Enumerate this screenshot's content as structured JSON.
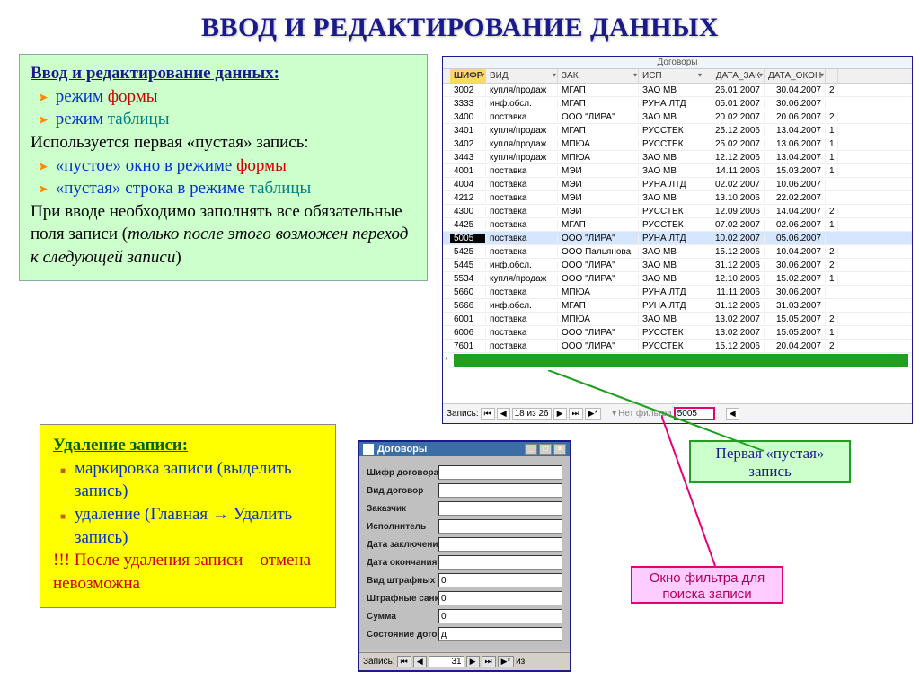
{
  "title": "ВВОД И РЕДАКТИРОВАНИЕ ДАННЫХ",
  "intro": {
    "heading": "Ввод и редактирование данных:",
    "b1_a": "режим ",
    "b1_b": "формы",
    "b2_a": "режим ",
    "b2_b": "таблицы",
    "line1": "Используется первая «пустая» запись:",
    "b3_a": "«пустое» окно в режиме ",
    "b3_b": "формы",
    "b4_a": "«пустая» строка в режиме ",
    "b4_b": "таблицы",
    "line2a": "При вводе необходимо заполнять все обязательные поля записи (",
    "line2b": "только после этого возможен переход к следующей записи",
    "line2c": ")"
  },
  "del": {
    "heading": "Удаление записи:",
    "b1": "маркировка записи (выделить запись)",
    "b2a": "удаление (Главная ",
    "b2arrow": "→",
    "b2b": "  Удалить запись)",
    "warn": "!!! После удаления записи – отмена невозможна"
  },
  "sheet": {
    "caption": "Договоры",
    "cols": [
      "ШИФР",
      "ВИД",
      "ЗАК",
      "ИСП",
      "ДАТА_ЗАК",
      "ДАТА_ОКОН",
      ""
    ],
    "rows": [
      [
        "3002",
        "купля/продаж",
        "МГАП",
        "ЗАО МВ",
        "26.01.2007",
        "30.04.2007",
        "2"
      ],
      [
        "3333",
        "инф.обсл.",
        "МГАП",
        "РУНА ЛТД",
        "05.01.2007",
        "30.06.2007",
        ""
      ],
      [
        "3400",
        "поставка",
        "ООО \"ЛИРА\"",
        "ЗАО МВ",
        "20.02.2007",
        "20.06.2007",
        "2"
      ],
      [
        "3401",
        "купля/продаж",
        "МГАП",
        "РУССТЕК",
        "25.12.2006",
        "13.04.2007",
        "1"
      ],
      [
        "3402",
        "купля/продаж",
        "МПЮА",
        "РУССТЕК",
        "25.02.2007",
        "13.06.2007",
        "1"
      ],
      [
        "3443",
        "купля/продаж",
        "МПЮА",
        "ЗАО МВ",
        "12.12.2006",
        "13.04.2007",
        "1"
      ],
      [
        "4001",
        "поставка",
        "МЭИ",
        "ЗАО МВ",
        "14.11.2006",
        "15.03.2007",
        "1"
      ],
      [
        "4004",
        "поставка",
        "МЭИ",
        "РУНА ЛТД",
        "02.02.2007",
        "10.06.2007",
        ""
      ],
      [
        "4212",
        "поставка",
        "МЭИ",
        "ЗАО МВ",
        "13.10.2006",
        "22.02.2007",
        ""
      ],
      [
        "4300",
        "поставка",
        "МЭИ",
        "РУССТЕК",
        "12.09.2006",
        "14.04.2007",
        "2"
      ],
      [
        "4425",
        "поставка",
        "МГАП",
        "РУССТЕК",
        "07.02.2007",
        "02.06.2007",
        "1"
      ],
      [
        "5005",
        "поставка",
        "ООО \"ЛИРА\"",
        "РУНА ЛТД",
        "10.02.2007",
        "05.06.2007",
        ""
      ],
      [
        "5425",
        "поставка",
        "ООО Пальянова",
        "ЗАО МВ",
        "15.12.2006",
        "10.04.2007",
        "2"
      ],
      [
        "5445",
        "инф.обсл.",
        "ООО \"ЛИРА\"",
        "ЗАО МВ",
        "31.12.2006",
        "30.06.2007",
        "2"
      ],
      [
        "5534",
        "купля/продаж",
        "ООО \"ЛИРА\"",
        "ЗАО МВ",
        "12.10.2006",
        "15.02.2007",
        "1"
      ],
      [
        "5660",
        "поставка",
        "МПЮА",
        "РУНА ЛТД",
        "11.11.2006",
        "30.06.2007",
        ""
      ],
      [
        "5666",
        "инф.обсл.",
        "МГАП",
        "РУНА ЛТД",
        "31.12.2006",
        "31.03.2007",
        ""
      ],
      [
        "6001",
        "поставка",
        "МПЮА",
        "ЗАО МВ",
        "13.02.2007",
        "15.05.2007",
        "2"
      ],
      [
        "6006",
        "поставка",
        "ООО \"ЛИРА\"",
        "РУССТЕК",
        "13.02.2007",
        "15.05.2007",
        "1"
      ],
      [
        "7601",
        "поставка",
        "ООО \"ЛИРА\"",
        "РУССТЕК",
        "15.12.2006",
        "20.04.2007",
        "2"
      ]
    ],
    "selected_index": 11,
    "nav": {
      "label": "Запись:",
      "pos": "18 из 26",
      "filter_label": "Нет фильтра",
      "filter_value": "5005"
    }
  },
  "form": {
    "title": "Договоры",
    "fields": [
      {
        "label": "Шифр договора",
        "value": ""
      },
      {
        "label": "Вид договор",
        "value": ""
      },
      {
        "label": "Заказчик",
        "value": ""
      },
      {
        "label": "Исполнитель",
        "value": ""
      },
      {
        "label": "Дата заключения",
        "value": ""
      },
      {
        "label": "Дата окончания",
        "value": ""
      },
      {
        "label": "Вид штрафных сан",
        "value": "0"
      },
      {
        "label": "Штрафные санкци",
        "value": "0"
      },
      {
        "label": "Сумма",
        "value": "0"
      },
      {
        "label": "Состояние догово",
        "value": "д"
      }
    ],
    "nav": {
      "label": "Запись:",
      "pos": "31",
      "of": "из"
    }
  },
  "callouts": {
    "empty_record": "Первая «пустая» запись",
    "filter": "Окно фильтра для поиска записи"
  }
}
